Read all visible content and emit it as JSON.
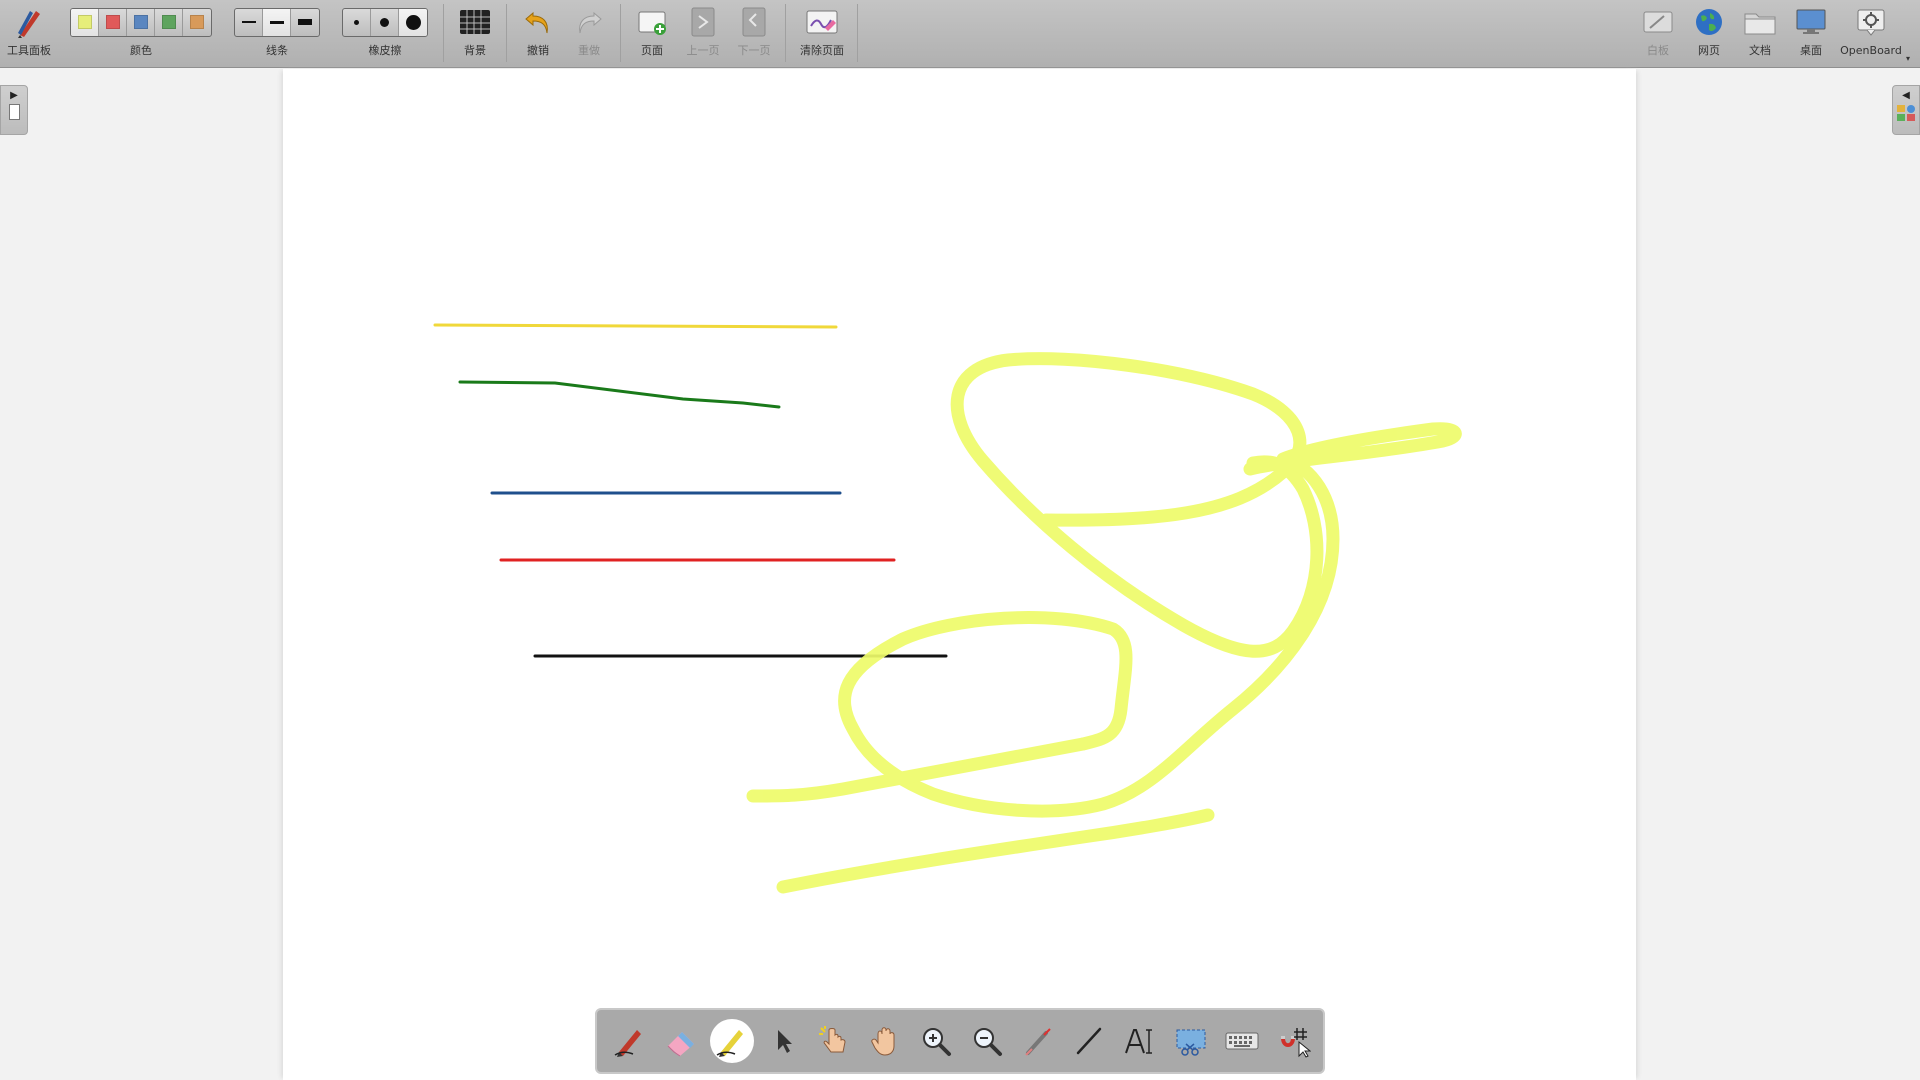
{
  "toolbar": {
    "tool_panel_label": "工具面板",
    "color_label": "颜色",
    "colors": [
      "#e6ee7a",
      "#e05a5a",
      "#5a86c0",
      "#5ea45e",
      "#d89a5a"
    ],
    "line_label": "线条",
    "eraser_label": "橡皮擦",
    "background_label": "背景",
    "undo_label": "撤销",
    "redo_label": "重做",
    "page_label": "页面",
    "prev_page_label": "上一页",
    "next_page_label": "下一页",
    "clear_page_label": "清除页面",
    "whiteboard_label": "白板",
    "web_label": "网页",
    "documents_label": "文档",
    "desktop_label": "桌面",
    "openboard_label": "OpenBoard"
  },
  "canvas": {
    "background": "#ffffff",
    "stroke_colors": {
      "yellow": "#f0d83a",
      "green": "#1a7a1a",
      "blue": "#1f4f8c",
      "red": "#e02222",
      "black": "#111111",
      "highlighter": "#eefb6a"
    }
  },
  "bottom_toolbar": {
    "tools": [
      "pen-tool",
      "eraser-tool",
      "highlighter-tool",
      "selector-tool",
      "interactive-pointer-tool",
      "hand-tool",
      "zoom-in-tool",
      "zoom-out-tool",
      "laser-pointer-tool",
      "line-tool",
      "text-tool",
      "capture-tool",
      "keyboard-tool",
      "magnet-grid-tool"
    ],
    "selected": "highlighter-tool"
  }
}
